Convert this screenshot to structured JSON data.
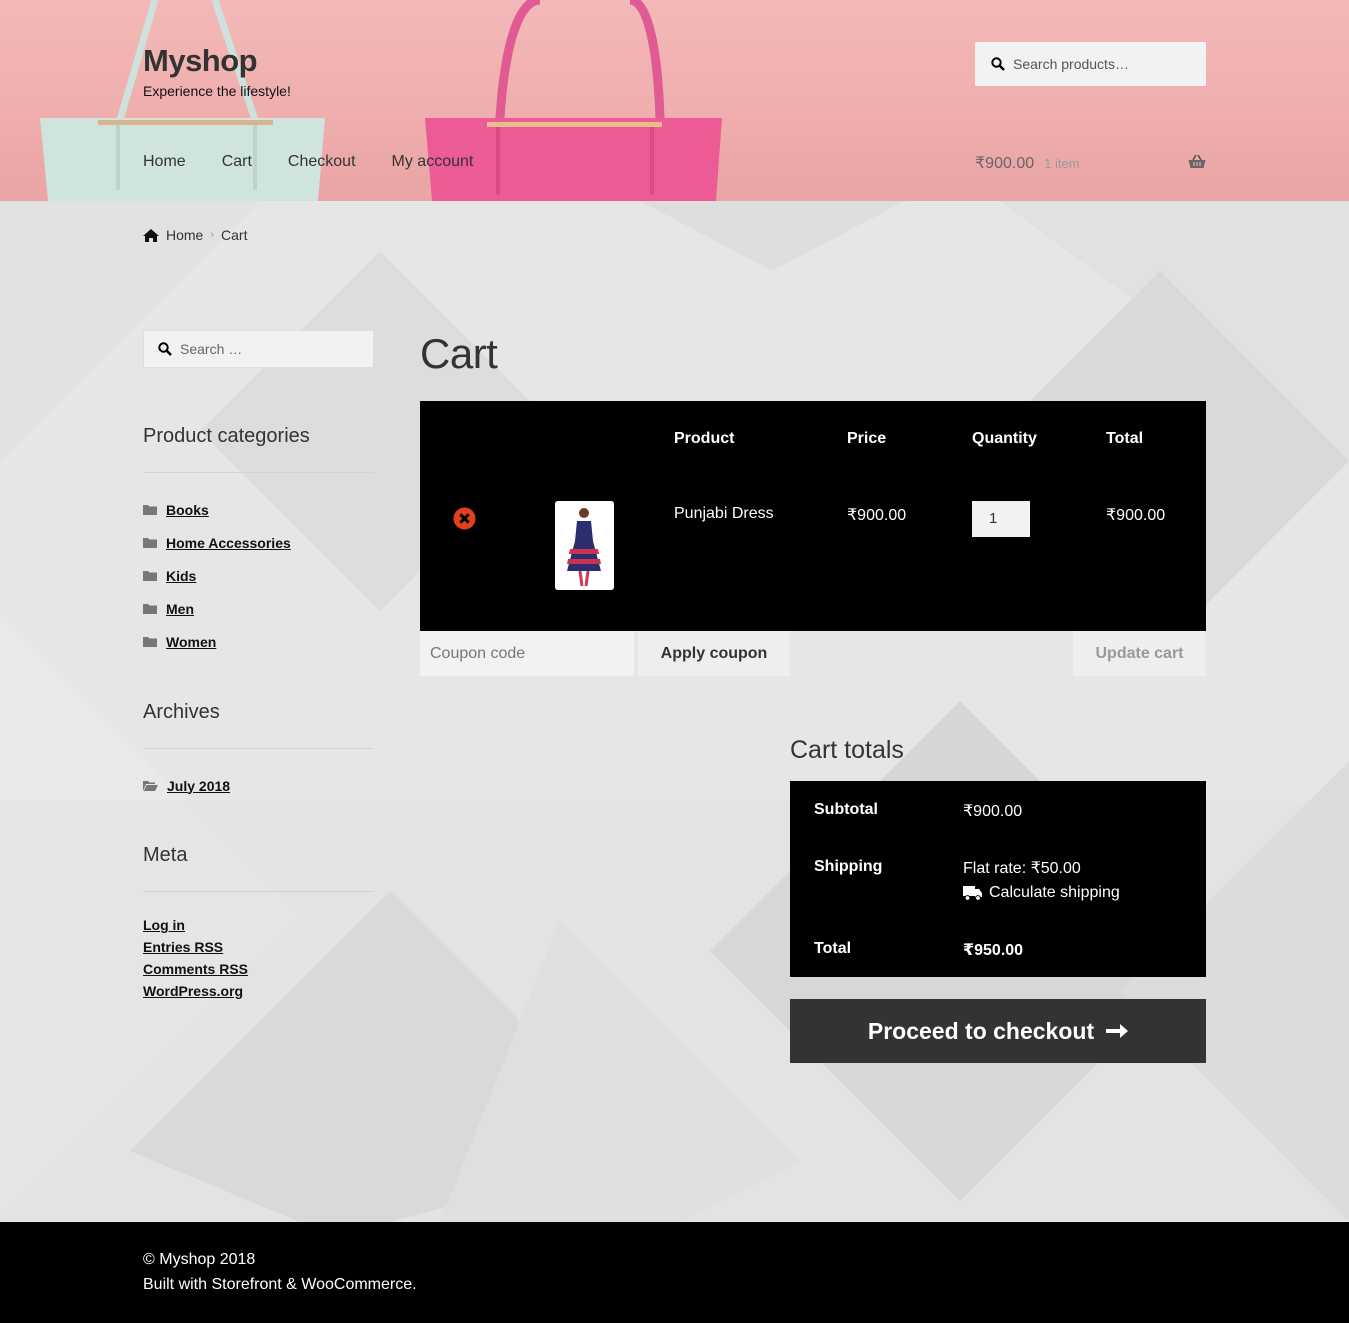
{
  "header": {
    "site_title": "Myshop",
    "tagline": "Experience the lifestyle!",
    "nav": [
      "Home",
      "Cart",
      "Checkout",
      "My account"
    ],
    "search_placeholder": "Search products…",
    "mini_cart_amount": "₹900.00",
    "mini_cart_count": "1 item"
  },
  "breadcrumb": {
    "home": "Home",
    "current": "Cart"
  },
  "sidebar": {
    "search_placeholder": "Search …",
    "categories_title": "Product categories",
    "categories": [
      "Books",
      "Home Accessories",
      "Kids",
      "Men",
      "Women"
    ],
    "archives_title": "Archives",
    "archives": [
      "July 2018"
    ],
    "meta_title": "Meta",
    "meta": [
      "Log in",
      "Entries RSS",
      "Comments RSS",
      "WordPress.org"
    ]
  },
  "main": {
    "page_title": "Cart",
    "table_headers": {
      "product": "Product",
      "price": "Price",
      "quantity": "Quantity",
      "total": "Total"
    },
    "item": {
      "name": "Punjabi Dress",
      "price": "₹900.00",
      "quantity": "1",
      "total": "₹900.00"
    },
    "coupon_placeholder": "Coupon code",
    "apply_coupon": "Apply coupon",
    "update_cart": "Update cart"
  },
  "totals": {
    "title": "Cart totals",
    "subtotal_label": "Subtotal",
    "subtotal": "₹900.00",
    "shipping_label": "Shipping",
    "shipping": "Flat rate: ₹50.00",
    "calculate_shipping": "Calculate shipping",
    "total_label": "Total",
    "total": "₹950.00",
    "checkout_button": "Proceed to checkout"
  },
  "footer": {
    "copyright": "© Myshop 2018",
    "credit": "Built with Storefront & WooCommerce."
  },
  "colors": {
    "header_bg": "#f0aeae",
    "table_bg": "#000000",
    "button_dark": "#333333",
    "remove_red": "#e2401c"
  }
}
